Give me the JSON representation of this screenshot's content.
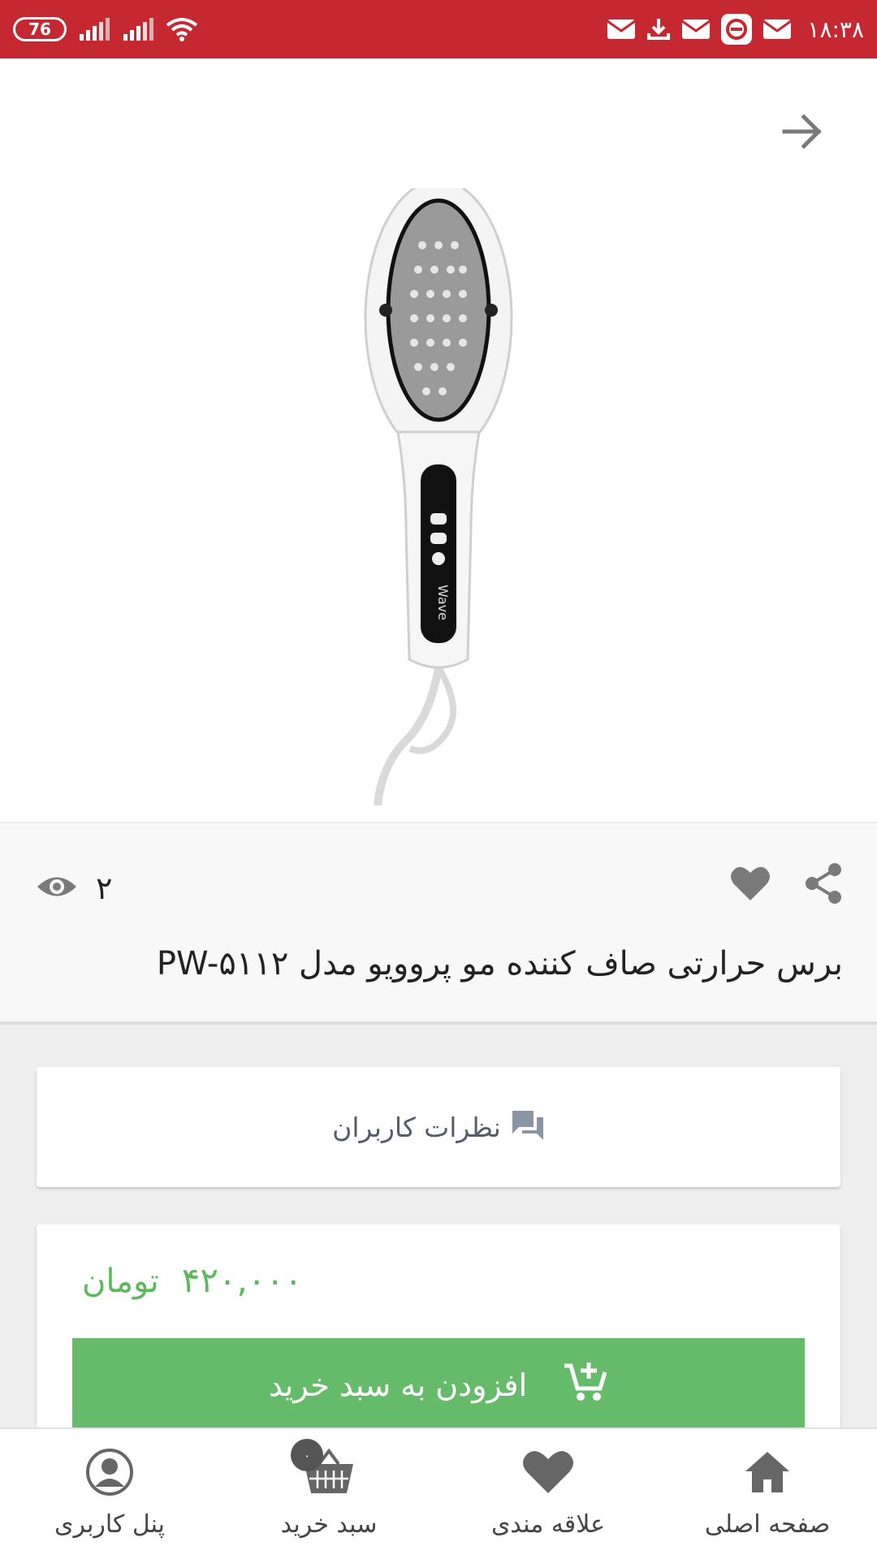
{
  "status_bar": {
    "time": "۱۸:۳۸",
    "battery": "76",
    "icons": [
      "mail-icon",
      "download-icon",
      "mail-icon",
      "app-icon",
      "mail-icon",
      "signal-icon",
      "signal-icon",
      "wifi-icon"
    ]
  },
  "image": {
    "brand_on_handle": "Wave"
  },
  "product": {
    "views": "۲",
    "title": "برس حرارتی صاف کننده مو پروویو مدل PW-۵۱۱۲"
  },
  "comments": {
    "label": "نظرات کاربران"
  },
  "purchase": {
    "price_amount": "۴۲۰,۰۰۰",
    "currency": "تومان",
    "add_to_cart": "افزودن به سبد خرید"
  },
  "nav": {
    "items": [
      {
        "label": "صفحه اصلی",
        "icon": "home-icon"
      },
      {
        "label": "علاقه مندی",
        "icon": "heart-icon"
      },
      {
        "label": "سبد خرید",
        "icon": "basket-icon",
        "badge": "۰"
      },
      {
        "label": "پنل کاربری",
        "icon": "user-icon"
      }
    ]
  },
  "colors": {
    "status_bar": "#c62832",
    "accent_green": "#66bb6a",
    "price_green": "#5cb85c",
    "icon_gray": "#7a7a7a"
  }
}
